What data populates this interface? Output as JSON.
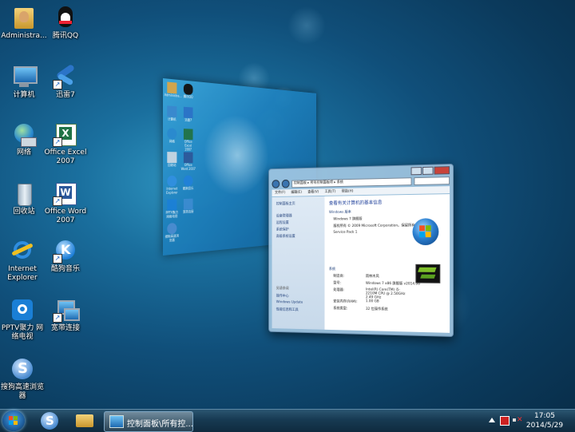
{
  "desktop": {
    "icons": [
      {
        "label": "Administra...",
        "icon": "user-folder-icon"
      },
      {
        "label": "腾讯QQ",
        "icon": "qq-penguin-icon"
      },
      {
        "label": "计算机",
        "icon": "computer-icon"
      },
      {
        "label": "迅雷7",
        "icon": "thunder-bird-icon"
      },
      {
        "label": "网络",
        "icon": "network-icon"
      },
      {
        "label": "Office Excel 2007",
        "icon": "excel-icon"
      },
      {
        "label": "回收站",
        "icon": "recycle-bin-icon"
      },
      {
        "label": "Office Word 2007",
        "icon": "word-icon"
      },
      {
        "label": "Internet Explorer",
        "icon": "ie-icon"
      },
      {
        "label": "酷狗音乐",
        "icon": "kugou-icon"
      },
      {
        "label": "PPTV聚力 网络电视",
        "icon": "pptv-icon"
      },
      {
        "label": "宽带连接",
        "icon": "broadband-icon"
      },
      {
        "label": "搜狗高速浏览器",
        "icon": "sogou-browser-icon"
      }
    ]
  },
  "flip_back": {
    "icons": [
      "Administra...",
      "腾讯QQ",
      "计算机",
      "迅雷7",
      "网络",
      "Office Excel 2007",
      "回收站",
      "Office Word 2007",
      "Internet Explorer",
      "酷狗音乐",
      "PPTV聚力 网络电视",
      "宽带连接",
      "搜狗高速浏览器"
    ]
  },
  "system_window": {
    "address": "控制面板 ▸ 所有控制面板项 ▸ 系统",
    "menu": [
      "文件(F)",
      "编辑(E)",
      "查看(V)",
      "工具(T)",
      "帮助(H)"
    ],
    "left_home": "控制面板主页",
    "left_links": [
      "设备管理器",
      "远程设置",
      "系统保护",
      "高级系统设置"
    ],
    "see_also_title": "另请参阅",
    "see_also": [
      "操作中心",
      "Windows Update",
      "性能信息和工具"
    ],
    "heading": "查看有关计算机的基本信息",
    "edition_title": "Windows 版本",
    "edition_lines": [
      "Windows 7 旗舰版",
      "版权所有 © 2009 Microsoft Corporation。保留所有权利。",
      "Service Pack 1"
    ],
    "system_title": "系统",
    "system_rows": [
      {
        "k": "制造商:",
        "v": "雨林木风"
      },
      {
        "k": "型号:",
        "v": "Windows 7 x86 旗舰版 v2014.06"
      },
      {
        "k": "处理器:",
        "v": "Intel(R) Core(TM) i5-2210M CPU @ 2.50GHz   2.49 GHz"
      },
      {
        "k": "安装内存(RAM):",
        "v": "1.00 GB"
      },
      {
        "k": "系统类型:",
        "v": "32 位操作系统"
      }
    ]
  },
  "taskbar": {
    "pinned": [
      "sogou-browser-icon",
      "folder-icon"
    ],
    "task_label": "控制面板\\所有控...",
    "clock_time": "17:05",
    "clock_date": "2014/5/29"
  }
}
